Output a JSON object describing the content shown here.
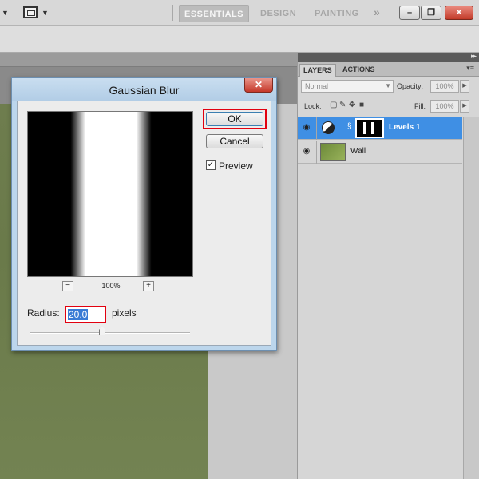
{
  "workspaces": {
    "essentials": "ESSENTIALS",
    "design": "DESIGN",
    "painting": "PAINTING",
    "more": "»"
  },
  "window_buttons": {
    "minimize": "–",
    "restore": "❐",
    "close": "✕"
  },
  "layers_panel": {
    "tabs": [
      "LAYERS",
      "ACTIONS"
    ],
    "menu_icon": "▾≡",
    "blend_mode": "Normal",
    "opacity_label": "Opacity:",
    "opacity_value": "100%",
    "lock_label": "Lock:",
    "fill_label": "Fill:",
    "fill_value": "100%",
    "layers": [
      {
        "name": "Levels 1",
        "selected": true,
        "visible": true,
        "type": "adjustment"
      },
      {
        "name": "Wall",
        "selected": false,
        "visible": true,
        "type": "image"
      }
    ]
  },
  "dialog": {
    "title": "Gaussian Blur",
    "close_label": "✕",
    "ok_label": "OK",
    "cancel_label": "Cancel",
    "preview_label": "Preview",
    "preview_checked": true,
    "zoom_out": "−",
    "zoom_in": "+",
    "zoom_level": "100%",
    "radius_label": "Radius:",
    "radius_value": "20.0",
    "radius_unit": "pixels",
    "radius_slider_fraction": 0.45
  },
  "colors": {
    "highlight": "#e2000f",
    "selection": "#3f8fe4",
    "canvas_green": "#6e7d4e"
  }
}
